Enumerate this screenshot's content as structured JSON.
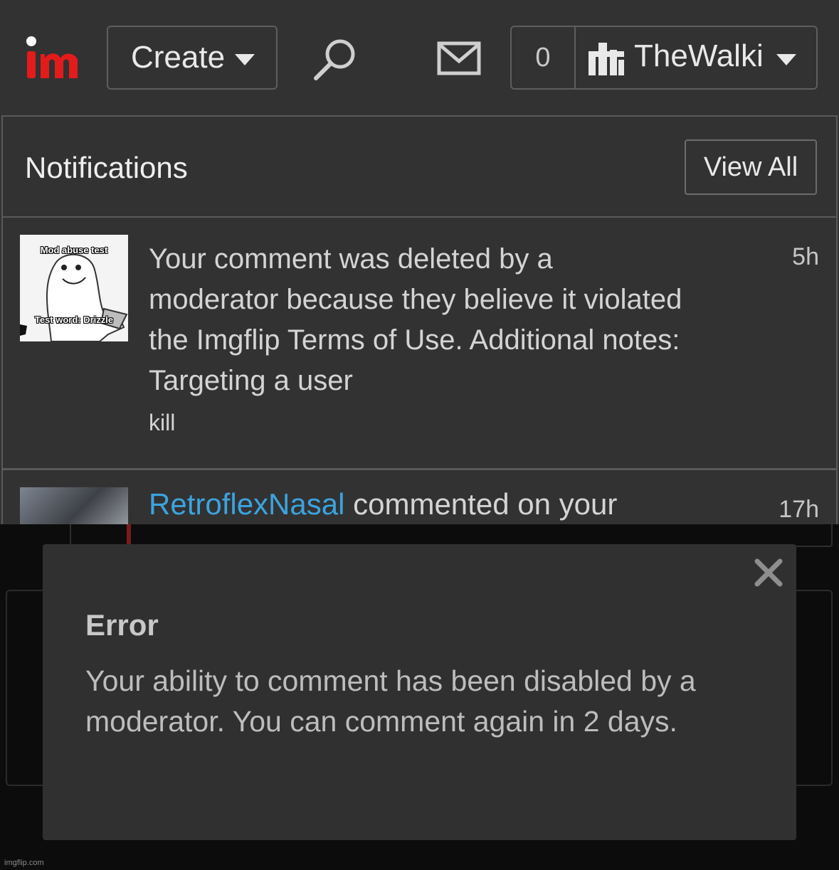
{
  "navbar": {
    "logo_alt": "im",
    "create_label": "Create",
    "notification_count": "0",
    "username": "TheWalki"
  },
  "notifications": {
    "title": "Notifications",
    "view_all_label": "View All",
    "items": [
      {
        "thumbnail_caption_top": "Mod abuse test",
        "thumbnail_caption_bottom": "Test word: Drizzle",
        "text": "Your comment was deleted by a moderator because they believe it violated the Imgflip Terms of Use. Additional notes: Targeting a user",
        "note": "kill",
        "time": "5h"
      },
      {
        "user": "RetroflexNasal",
        "text": " commented on your",
        "time": "17h"
      }
    ]
  },
  "error_dialog": {
    "title": "Error",
    "message": "Your ability to comment has been disabled by a moderator. You can comment again in 2 days."
  },
  "watermark": "imgflip.com",
  "colors": {
    "background": "#323232",
    "link": "#3ba4e0",
    "logo": "#e31b1b"
  }
}
